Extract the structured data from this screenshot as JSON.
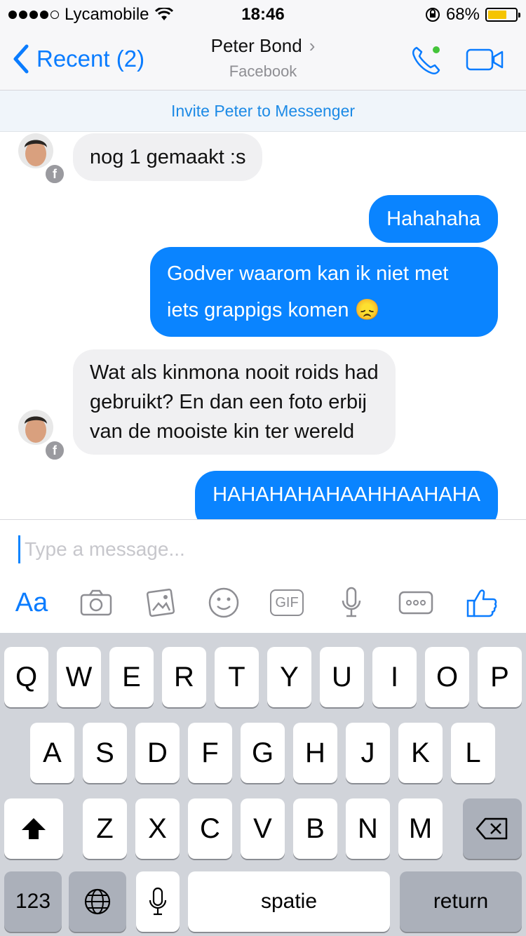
{
  "status_bar": {
    "carrier": "Lycamobile",
    "time": "18:46",
    "battery_percent": "68%",
    "battery_level": 0.68,
    "signal_bars": 4
  },
  "nav": {
    "back_label": "Recent (2)",
    "contact_name": "Peter Bond",
    "contact_source": "Facebook"
  },
  "invite_text": "Invite Peter to Messenger",
  "messages": [
    {
      "direction": "incoming",
      "text": "nog 1 gemaakt :s"
    },
    {
      "direction": "outgoing",
      "text": "Hahahaha"
    },
    {
      "direction": "outgoing",
      "line1": "Godver waarom kan ik niet met",
      "line2": "iets grappigs komen",
      "emoji": "😞"
    },
    {
      "direction": "incoming",
      "line1": "Wat als kinmona nooit roids had",
      "line2": "gebruikt? En dan een foto erbij",
      "line3": "van de mooiste kin ter wereld"
    },
    {
      "direction": "outgoing",
      "text": "HAHAHAHAHAAHHAAHAHA"
    }
  ],
  "composer": {
    "placeholder": "Type a message...",
    "aa_label": "Aa",
    "gif_label": "GIF",
    "icons": [
      "camera-icon",
      "photo-gallery-icon",
      "emoji-icon",
      "gif-icon",
      "microphone-icon",
      "more-icon",
      "thumbs-up-icon"
    ]
  },
  "keyboard": {
    "row1": [
      "Q",
      "W",
      "E",
      "R",
      "T",
      "Y",
      "U",
      "I",
      "O",
      "P"
    ],
    "row2": [
      "A",
      "S",
      "D",
      "F",
      "G",
      "H",
      "J",
      "K",
      "L"
    ],
    "row3": [
      "Z",
      "X",
      "C",
      "V",
      "B",
      "N",
      "M"
    ],
    "numbers_label": "123",
    "space_label": "spatie",
    "return_label": "return"
  },
  "colors": {
    "accent": "#0a84ff",
    "incoming_bubble": "#f0f0f2",
    "online_dot": "#44c43a",
    "battery": "#f5c400"
  }
}
